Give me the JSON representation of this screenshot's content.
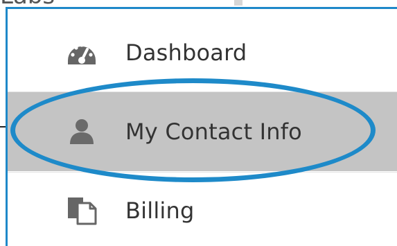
{
  "background": {
    "peek_text": "Labs"
  },
  "menu": {
    "border_color": "#1e88c9",
    "items": [
      {
        "label": "Dashboard",
        "icon": "dashboard-gauge-icon",
        "selected": false
      },
      {
        "label": "My Contact Info",
        "icon": "user-icon",
        "selected": true
      },
      {
        "label": "Billing",
        "icon": "billing-document-icon",
        "selected": false
      }
    ],
    "selected_background": "#c4c4c4"
  },
  "annotation": {
    "type": "highlight-oval",
    "color": "#1e8ac9",
    "target": "My Contact Info"
  }
}
